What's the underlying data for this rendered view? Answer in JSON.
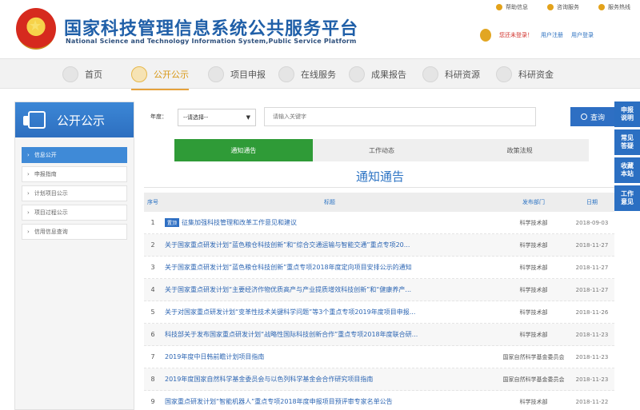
{
  "header": {
    "title": "国家科技管理信息系统公共服务平台",
    "subtitle": "National Science and Technology Information System,Public Service Platform",
    "top_links": [
      "帮助信息",
      "咨询服务",
      "服务热线"
    ],
    "login_status": "您还未登录！",
    "login_links": [
      "用户注册",
      "用户登录"
    ]
  },
  "nav": {
    "items": [
      "首页",
      "公开公示",
      "项目申报",
      "在线服务",
      "成果报告",
      "科研资源",
      "科研资金"
    ],
    "active_index": 1
  },
  "sidebar": {
    "title": "公开公示",
    "items": [
      "信息公开",
      "申报指南",
      "计划项目公示",
      "项目过程公示",
      "信用信息查询"
    ],
    "active_index": 0
  },
  "search": {
    "year_label": "年度：",
    "year_value": "--请选择--",
    "placeholder": "请输入关键字",
    "button_label": "查询"
  },
  "tabs": {
    "items": [
      "通知通告",
      "工作动态",
      "政策法规"
    ],
    "active_index": 0
  },
  "section_title": "通知通告",
  "table": {
    "headers": {
      "no": "序号",
      "title": "标题",
      "dept": "发布部门",
      "date": "日期"
    },
    "badge": "置顶",
    "rows": [
      {
        "no": "1",
        "title": "征集加强科技管理和改革工作意见和建议",
        "dept": "科学技术部",
        "date": "2018-09-03",
        "badge": true
      },
      {
        "no": "2",
        "title": "关于国家重点研发计划“蓝色粮仓科技创新”和“综合交通运输与智能交通”重点专项20...",
        "dept": "科学技术部",
        "date": "2018-11-27",
        "badge": false
      },
      {
        "no": "3",
        "title": "关于国家重点研发计划“蓝色粮仓科技创新”重点专项2018年度定向项目安排公示的通知",
        "dept": "科学技术部",
        "date": "2018-11-27",
        "badge": false
      },
      {
        "no": "4",
        "title": "关于国家重点研发计划“主要经济作物优质高产与产业提质增效科技创新”和“健康养产...",
        "dept": "科学技术部",
        "date": "2018-11-27",
        "badge": false
      },
      {
        "no": "5",
        "title": "关于对国家重点研发计划“变革性技术关键科学问题”等3个重点专项2019年度项目申报...",
        "dept": "科学技术部",
        "date": "2018-11-26",
        "badge": false
      },
      {
        "no": "6",
        "title": "科技部关于发布国家重点研发计划“战略性国际科技创新合作”重点专项2018年度联合研...",
        "dept": "科学技术部",
        "date": "2018-11-23",
        "badge": false
      },
      {
        "no": "7",
        "title": "2019年度中日韩前瞻计划项目指南",
        "dept": "国家自然科学基金委员会",
        "date": "2018-11-23",
        "badge": false
      },
      {
        "no": "8",
        "title": "2019年度国家自然科学基金委员会与以色列科学基金会合作研究项目指南",
        "dept": "国家自然科学基金委员会",
        "date": "2018-11-23",
        "badge": false
      },
      {
        "no": "9",
        "title": "国家重点研发计划“智能机器人”重点专项2018年度申报项目预评审专家名单公告",
        "dept": "科学技术部",
        "date": "2018-11-22",
        "badge": false
      }
    ]
  },
  "float": [
    "申报说明",
    "常见答疑",
    "收藏本站",
    "工作意见"
  ]
}
